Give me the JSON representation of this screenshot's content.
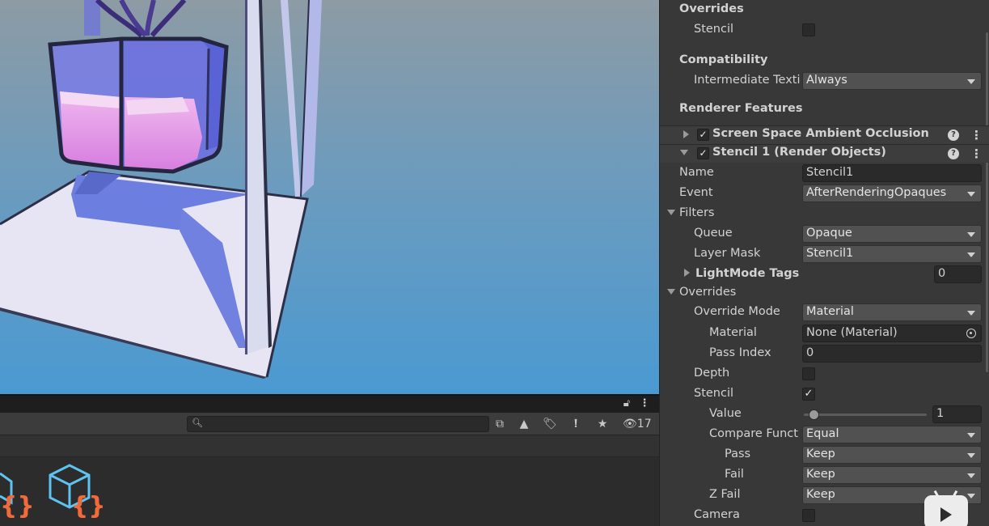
{
  "scene": {
    "description_colors": {
      "sky_top": "#8a9aa5",
      "sky_bottom": "#4f9bd0",
      "glass_blue": "#6f73e0",
      "liquid_pink": "#e58ee6",
      "floor_white": "#e6e4f2"
    }
  },
  "project": {
    "search": {
      "value": "",
      "placeholder": ""
    },
    "hidden_count": "17"
  },
  "inspector": {
    "overrides_top": {
      "title": "Overrides",
      "stencil_label": "Stencil",
      "stencil_checked": false
    },
    "compatibility": {
      "title": "Compatibility",
      "intermediate_label": "Intermediate Texti",
      "intermediate_value": "Always"
    },
    "renderer_features": {
      "title": "Renderer Features",
      "features": [
        {
          "label": "Screen Space Ambient Occlusion",
          "enabled": true,
          "expanded": false
        },
        {
          "label": "Stencil 1 (Render Objects)",
          "enabled": true,
          "expanded": true
        }
      ]
    },
    "stencil_feature": {
      "name_label": "Name",
      "name_value": "Stencil1",
      "event_label": "Event",
      "event_value": "AfterRenderingOpaques",
      "filters": {
        "title": "Filters",
        "queue_label": "Queue",
        "queue_value": "Opaque",
        "layer_mask_label": "Layer Mask",
        "layer_mask_value": "Stencil1",
        "lightmode_label": "LightMode Tags",
        "lightmode_value": "0"
      },
      "overrides": {
        "title": "Overrides",
        "override_mode_label": "Override Mode",
        "override_mode_value": "Material",
        "material_label": "Material",
        "material_value": "None (Material)",
        "pass_index_label": "Pass Index",
        "pass_index_value": "0",
        "depth_label": "Depth",
        "depth_checked": false,
        "stencil_label": "Stencil",
        "stencil_checked": true,
        "value_label": "Value",
        "value_value": "1",
        "compare_label": "Compare Funct",
        "compare_value": "Equal",
        "pass_label": "Pass",
        "pass_value": "Keep",
        "fail_label": "Fail",
        "fail_value": "Keep",
        "zfail_label": "Z Fail",
        "zfail_value": "Keep",
        "camera_label": "Camera",
        "camera_checked": false
      }
    }
  }
}
